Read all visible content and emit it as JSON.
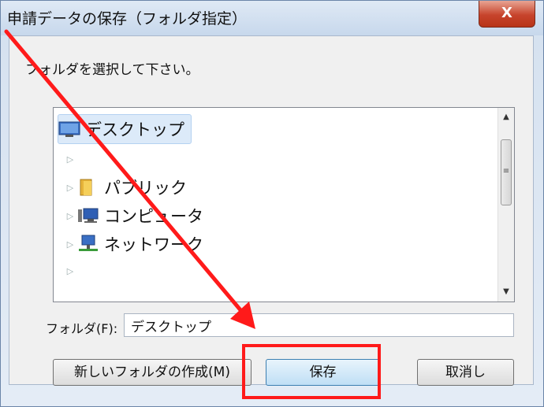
{
  "window": {
    "title": "申請データの保存（フォルダ指定）",
    "close_label": "X"
  },
  "dialog": {
    "prompt": "フォルダを選択して下さい。",
    "tree_items": [
      {
        "label": "デスクトップ",
        "icon": "desktop-icon",
        "selected": true
      },
      {
        "label": "",
        "icon": "",
        "selected": false
      },
      {
        "label": "パブリック",
        "icon": "folder-icon",
        "selected": false
      },
      {
        "label": "コンピュータ",
        "icon": "computer-icon",
        "selected": false
      },
      {
        "label": "ネットワーク",
        "icon": "network-icon",
        "selected": false
      },
      {
        "label": "",
        "icon": "",
        "selected": false
      }
    ],
    "folder_label": "フォルダ(F):",
    "folder_value": "デスクトップ",
    "buttons": {
      "new_folder": "新しいフォルダの作成(M)",
      "save": "保存",
      "cancel": "取消し"
    }
  },
  "annotation": {
    "color": "#ff1a1a"
  }
}
